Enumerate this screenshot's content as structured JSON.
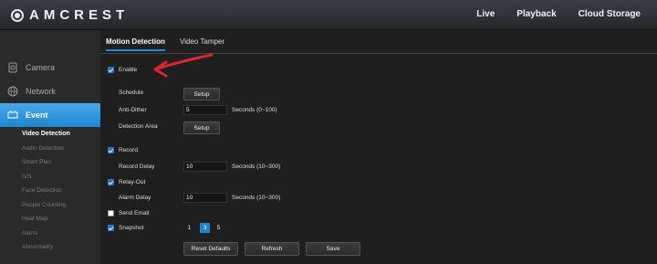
{
  "brand": {
    "name": "AMCREST"
  },
  "topnav": {
    "live": "Live",
    "playback": "Playback",
    "cloud": "Cloud Storage"
  },
  "sidebar": {
    "camera": "Camera",
    "network": "Network",
    "event": "Event",
    "sub_items": [
      "Video Detection",
      "Audio Detection",
      "Smart Plan",
      "IVS",
      "Face Detection",
      "People Counting",
      "Heat Map",
      "Alarm",
      "Abnormality"
    ]
  },
  "tabs": {
    "motion": "Motion Detection",
    "tamper": "Video Tamper"
  },
  "form": {
    "enable": {
      "label": "Enable",
      "checked": true
    },
    "schedule": {
      "label": "Schedule",
      "button": "Setup"
    },
    "anti_dither": {
      "label": "Anti-Dither",
      "value": "5",
      "unit": "Seconds (0~100)"
    },
    "detection_area": {
      "label": "Detection Area",
      "button": "Setup"
    },
    "record": {
      "label": "Record",
      "checked": true
    },
    "record_delay": {
      "label": "Record Delay",
      "value": "10",
      "unit": "Seconds (10~300)"
    },
    "relay_out": {
      "label": "Relay-Out",
      "checked": true
    },
    "alarm_delay": {
      "label": "Alarm Delay",
      "value": "10",
      "unit": "Seconds (10~300)"
    },
    "send_email": {
      "label": "Send Email",
      "checked": false
    },
    "snapshot": {
      "label": "Snapshot",
      "checked": true,
      "options": [
        "1",
        "3",
        "5"
      ],
      "selected": "3"
    }
  },
  "actions": {
    "reset": "Reset Defaults",
    "refresh": "Refresh",
    "save": "Save"
  },
  "colors": {
    "accent": "#1e86d4",
    "annotation_arrow": "#e0242a"
  }
}
